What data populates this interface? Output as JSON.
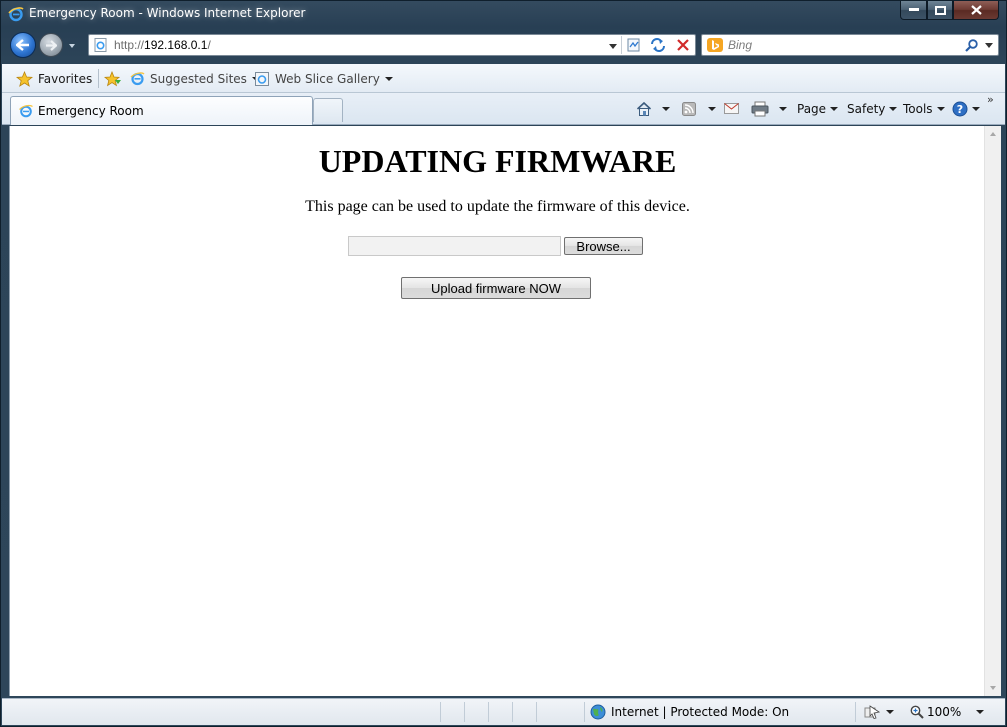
{
  "window": {
    "title": "Emergency Room - Windows Internet Explorer"
  },
  "address": {
    "scheme": "http://",
    "host": "192.168.0.1",
    "path": "/"
  },
  "search": {
    "placeholder": "Bing"
  },
  "favorites_bar": {
    "favorites_label": "Favorites",
    "suggested_sites_label": "Suggested Sites",
    "web_slice_gallery_label": "Web Slice Gallery"
  },
  "tab": {
    "active_title": "Emergency Room"
  },
  "command_bar": {
    "page_label": "Page",
    "safety_label": "Safety",
    "tools_label": "Tools"
  },
  "page": {
    "heading": "UPDATING FIRMWARE",
    "description": "This page can be used to update the firmware of this device.",
    "browse_label": "Browse...",
    "upload_label": "Upload firmware NOW"
  },
  "status_bar": {
    "zone_text": "Internet | Protected Mode: On",
    "zoom": "100%"
  }
}
